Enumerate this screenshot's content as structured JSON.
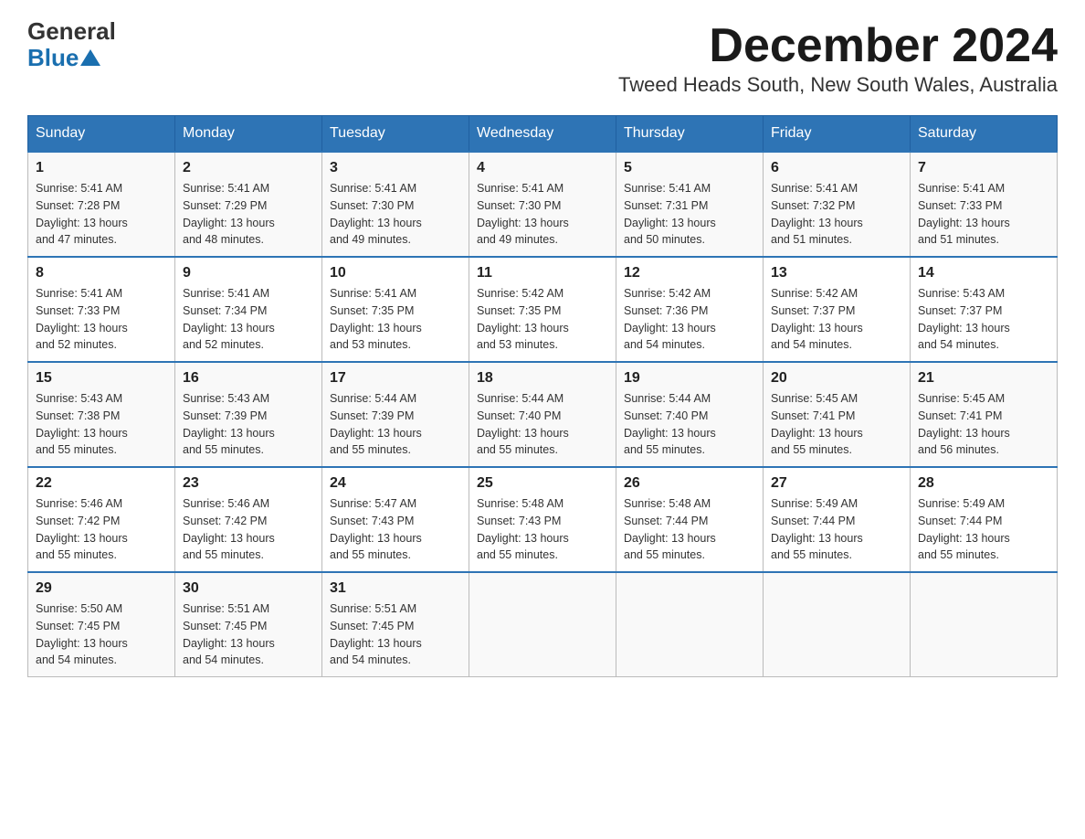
{
  "header": {
    "logo_general": "General",
    "logo_blue": "Blue",
    "month_title": "December 2024",
    "location": "Tweed Heads South, New South Wales, Australia"
  },
  "weekdays": [
    "Sunday",
    "Monday",
    "Tuesday",
    "Wednesday",
    "Thursday",
    "Friday",
    "Saturday"
  ],
  "weeks": [
    [
      {
        "day": "1",
        "sunrise": "5:41 AM",
        "sunset": "7:28 PM",
        "daylight": "13 hours and 47 minutes."
      },
      {
        "day": "2",
        "sunrise": "5:41 AM",
        "sunset": "7:29 PM",
        "daylight": "13 hours and 48 minutes."
      },
      {
        "day": "3",
        "sunrise": "5:41 AM",
        "sunset": "7:30 PM",
        "daylight": "13 hours and 49 minutes."
      },
      {
        "day": "4",
        "sunrise": "5:41 AM",
        "sunset": "7:30 PM",
        "daylight": "13 hours and 49 minutes."
      },
      {
        "day": "5",
        "sunrise": "5:41 AM",
        "sunset": "7:31 PM",
        "daylight": "13 hours and 50 minutes."
      },
      {
        "day": "6",
        "sunrise": "5:41 AM",
        "sunset": "7:32 PM",
        "daylight": "13 hours and 51 minutes."
      },
      {
        "day": "7",
        "sunrise": "5:41 AM",
        "sunset": "7:33 PM",
        "daylight": "13 hours and 51 minutes."
      }
    ],
    [
      {
        "day": "8",
        "sunrise": "5:41 AM",
        "sunset": "7:33 PM",
        "daylight": "13 hours and 52 minutes."
      },
      {
        "day": "9",
        "sunrise": "5:41 AM",
        "sunset": "7:34 PM",
        "daylight": "13 hours and 52 minutes."
      },
      {
        "day": "10",
        "sunrise": "5:41 AM",
        "sunset": "7:35 PM",
        "daylight": "13 hours and 53 minutes."
      },
      {
        "day": "11",
        "sunrise": "5:42 AM",
        "sunset": "7:35 PM",
        "daylight": "13 hours and 53 minutes."
      },
      {
        "day": "12",
        "sunrise": "5:42 AM",
        "sunset": "7:36 PM",
        "daylight": "13 hours and 54 minutes."
      },
      {
        "day": "13",
        "sunrise": "5:42 AM",
        "sunset": "7:37 PM",
        "daylight": "13 hours and 54 minutes."
      },
      {
        "day": "14",
        "sunrise": "5:43 AM",
        "sunset": "7:37 PM",
        "daylight": "13 hours and 54 minutes."
      }
    ],
    [
      {
        "day": "15",
        "sunrise": "5:43 AM",
        "sunset": "7:38 PM",
        "daylight": "13 hours and 55 minutes."
      },
      {
        "day": "16",
        "sunrise": "5:43 AM",
        "sunset": "7:39 PM",
        "daylight": "13 hours and 55 minutes."
      },
      {
        "day": "17",
        "sunrise": "5:44 AM",
        "sunset": "7:39 PM",
        "daylight": "13 hours and 55 minutes."
      },
      {
        "day": "18",
        "sunrise": "5:44 AM",
        "sunset": "7:40 PM",
        "daylight": "13 hours and 55 minutes."
      },
      {
        "day": "19",
        "sunrise": "5:44 AM",
        "sunset": "7:40 PM",
        "daylight": "13 hours and 55 minutes."
      },
      {
        "day": "20",
        "sunrise": "5:45 AM",
        "sunset": "7:41 PM",
        "daylight": "13 hours and 55 minutes."
      },
      {
        "day": "21",
        "sunrise": "5:45 AM",
        "sunset": "7:41 PM",
        "daylight": "13 hours and 56 minutes."
      }
    ],
    [
      {
        "day": "22",
        "sunrise": "5:46 AM",
        "sunset": "7:42 PM",
        "daylight": "13 hours and 55 minutes."
      },
      {
        "day": "23",
        "sunrise": "5:46 AM",
        "sunset": "7:42 PM",
        "daylight": "13 hours and 55 minutes."
      },
      {
        "day": "24",
        "sunrise": "5:47 AM",
        "sunset": "7:43 PM",
        "daylight": "13 hours and 55 minutes."
      },
      {
        "day": "25",
        "sunrise": "5:48 AM",
        "sunset": "7:43 PM",
        "daylight": "13 hours and 55 minutes."
      },
      {
        "day": "26",
        "sunrise": "5:48 AM",
        "sunset": "7:44 PM",
        "daylight": "13 hours and 55 minutes."
      },
      {
        "day": "27",
        "sunrise": "5:49 AM",
        "sunset": "7:44 PM",
        "daylight": "13 hours and 55 minutes."
      },
      {
        "day": "28",
        "sunrise": "5:49 AM",
        "sunset": "7:44 PM",
        "daylight": "13 hours and 55 minutes."
      }
    ],
    [
      {
        "day": "29",
        "sunrise": "5:50 AM",
        "sunset": "7:45 PM",
        "daylight": "13 hours and 54 minutes."
      },
      {
        "day": "30",
        "sunrise": "5:51 AM",
        "sunset": "7:45 PM",
        "daylight": "13 hours and 54 minutes."
      },
      {
        "day": "31",
        "sunrise": "5:51 AM",
        "sunset": "7:45 PM",
        "daylight": "13 hours and 54 minutes."
      },
      null,
      null,
      null,
      null
    ]
  ],
  "labels": {
    "sunrise": "Sunrise:",
    "sunset": "Sunset:",
    "daylight": "Daylight:"
  }
}
